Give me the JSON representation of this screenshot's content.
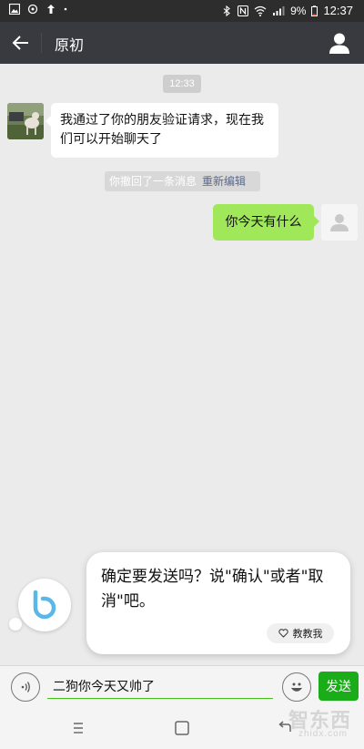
{
  "status_bar": {
    "battery": "9%",
    "time": "12:37",
    "left_icons": [
      "gallery-icon",
      "sync-icon",
      "upload-icon",
      "dot-icon"
    ],
    "right_icons": [
      "bluetooth-icon",
      "nfc-icon",
      "wifi-icon",
      "signal-icon",
      "battery-icon"
    ]
  },
  "app_bar": {
    "title": "原初",
    "back_icon": "arrow-left-icon",
    "profile_icon": "person-icon"
  },
  "chat": {
    "time_label": "12:33",
    "incoming_message": "我通过了你的朋友验证请求，现在我们可以开始聊天了",
    "recall_notice": "你撤回了一条消息",
    "reedit_link": "重新编辑",
    "outgoing_message": "你今天有什么"
  },
  "assistant": {
    "prompt": "确定要发送吗？说\"确认\"或者\"取消\"吧。",
    "teach_label": "教教我",
    "teach_icon": "heart-icon"
  },
  "input_bar": {
    "value": "二狗你今天又帅了",
    "send_label": "发送"
  },
  "watermark": {
    "main": "智东西",
    "sub": "zhidx.com"
  },
  "colors": {
    "app_bar": "#393a3f",
    "outgoing_bubble": "#a0e75a",
    "send_button": "#1aad19",
    "background": "#ebebeb"
  }
}
